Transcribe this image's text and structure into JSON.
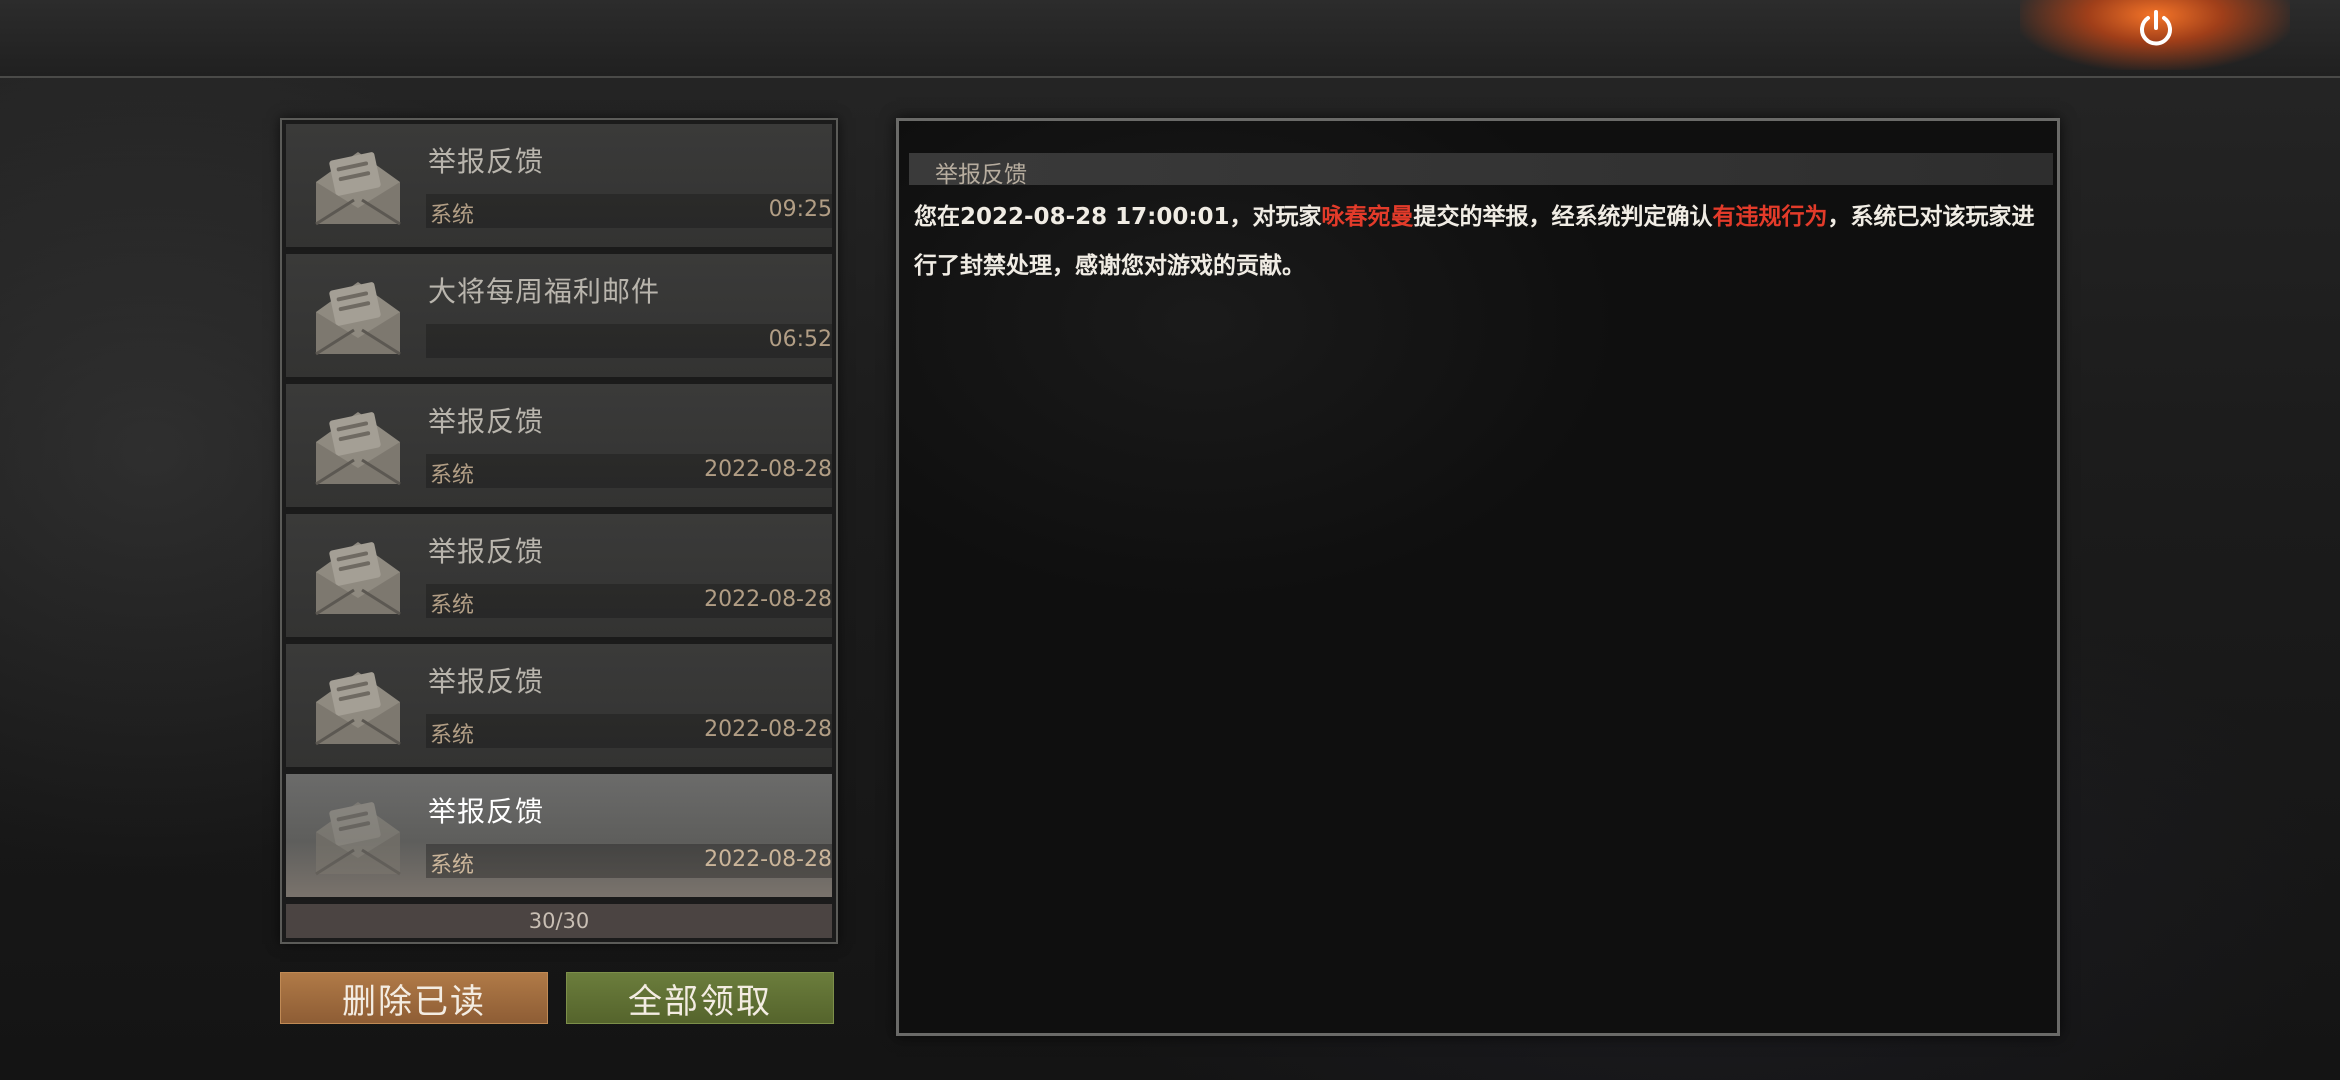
{
  "power_button": {
    "icon": "power-icon",
    "color": "#ffffff",
    "glow": "#ff7a28"
  },
  "mail_list": {
    "items": [
      {
        "title": "举报反馈",
        "sender": "系统",
        "time": "09:25",
        "selected": false
      },
      {
        "title": "大将每周福利邮件",
        "sender": "",
        "time": "06:52",
        "selected": false
      },
      {
        "title": "举报反馈",
        "sender": "系统",
        "time": "2022-08-28",
        "selected": false
      },
      {
        "title": "举报反馈",
        "sender": "系统",
        "time": "2022-08-28",
        "selected": false
      },
      {
        "title": "举报反馈",
        "sender": "系统",
        "time": "2022-08-28",
        "selected": false
      },
      {
        "title": "举报反馈",
        "sender": "系统",
        "time": "2022-08-28",
        "selected": true
      }
    ],
    "count": "30/30",
    "icon": "open-envelope-icon"
  },
  "buttons": {
    "delete_read": "删除已读",
    "claim_all": "全部领取",
    "delete_color": "#a06c3e",
    "claim_color": "#5f7033"
  },
  "content": {
    "header": "举报反馈",
    "body_part1": "您在2022-08-28 17:00:01，对玩家",
    "player_name": "咏春宛曼",
    "body_part2": "提交的举报，经系统判定确认",
    "verdict": "有违规行为",
    "body_part3": "，系统已对该玩家进行了封禁处理，感谢您对游戏的贡献。",
    "highlight_color": "#e33b2a"
  }
}
